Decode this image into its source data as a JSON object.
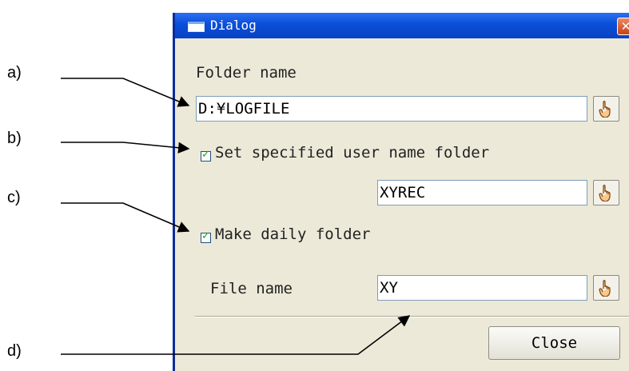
{
  "callouts": {
    "a": "a)",
    "b": "b)",
    "c": "c)",
    "d": "d)"
  },
  "dialog": {
    "title": "Dialog",
    "folder_label": "Folder name",
    "folder_value": "D:¥LOGFILE",
    "user_folder": {
      "checked": true,
      "label": "Set specified user name folder",
      "value": "XYREC"
    },
    "daily_folder": {
      "checked": true,
      "label": "Make daily folder"
    },
    "file_name_label": "File name",
    "file_name_value": "XY",
    "close_label": "Close"
  },
  "icons": {
    "browse": "pointing-hand-icon",
    "check": "checkmark-icon",
    "close": "close-x-icon"
  },
  "colors": {
    "titlebar": "#0a4ed8",
    "dialog_bg": "#ece9d8",
    "close_button": "#d9582f"
  }
}
